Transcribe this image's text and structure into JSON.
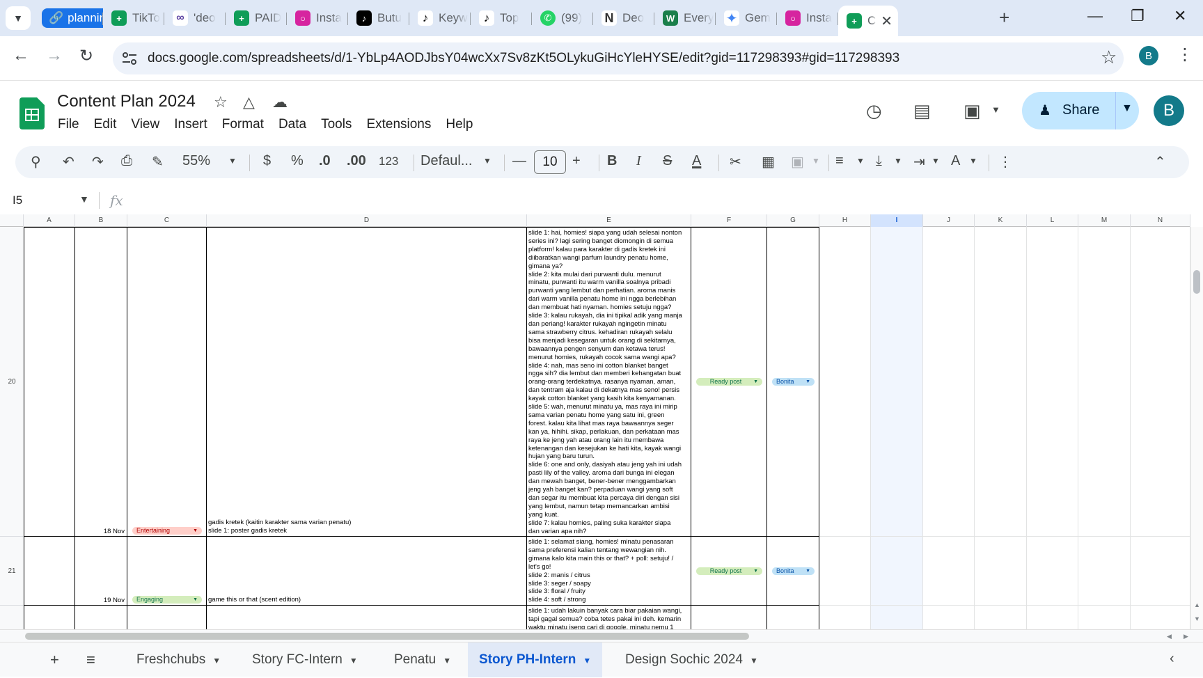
{
  "browser": {
    "tab_group_label": "planning",
    "tabs": [
      {
        "title": "TikTo",
        "icon": "sheets-icon",
        "color": "#0f9d58"
      },
      {
        "title": "'deo",
        "icon": "claude-icon",
        "color": "#5b3fa0"
      },
      {
        "title": "PAID",
        "icon": "sheets-icon",
        "color": "#0f9d58"
      },
      {
        "title": "Insta",
        "icon": "instagram-icon",
        "color": "#d6249f"
      },
      {
        "title": "Butu",
        "icon": "tiktok-icon",
        "color": "#000000"
      },
      {
        "title": "Keyw",
        "icon": "tiktok-icon",
        "color": "#000000"
      },
      {
        "title": "Top",
        "icon": "tiktok-icon",
        "color": "#000000"
      },
      {
        "title": "(99)",
        "icon": "whatsapp-icon",
        "color": "#25d366"
      },
      {
        "title": "Deo",
        "icon": "notion-icon",
        "color": "#333333"
      },
      {
        "title": "Every",
        "icon": "wix-icon",
        "color": "#1a7f4b"
      },
      {
        "title": "Gem",
        "icon": "gemini-icon",
        "color": "#4285f4"
      },
      {
        "title": "Insta",
        "icon": "instagram-icon",
        "color": "#d6249f"
      }
    ],
    "active_tab_title": "C",
    "url": "docs.google.com/spreadsheets/d/1-YbLp4AODJbsY04wcXx7Sv8zKt5OLykuGiHcYleHYSE/edit?gid=117298393#gid=117298393",
    "profile_initial": "B"
  },
  "sheets": {
    "title": "Content Plan 2024",
    "menu": [
      "File",
      "Edit",
      "View",
      "Insert",
      "Format",
      "Data",
      "Tools",
      "Extensions",
      "Help"
    ],
    "share_label": "Share",
    "account_initial": "B",
    "toolbar": {
      "zoom": "55%",
      "currency": "$",
      "percent": "%",
      "decrease_decimal": ".0",
      "increase_decimal": ".00",
      "number_format": "123",
      "font": "Defaul...",
      "font_size": "10"
    },
    "namebox": "I5",
    "fx": "fx"
  },
  "grid": {
    "columns": [
      "A",
      "B",
      "C",
      "D",
      "E",
      "F",
      "G",
      "H",
      "I",
      "J",
      "K",
      "L",
      "M",
      "N"
    ],
    "selected_column": "I",
    "rows": [
      {
        "number": "20",
        "date": "18 Nov",
        "category": "Entertaining",
        "title_lines": [
          "gadis kretek (kaitin karakter sama varian penatu)",
          "slide 1: poster gadis kretek"
        ],
        "script_lines": [
          "slide 1: hai, homies! siapa yang udah selesai nonton",
          "series ini? lagi sering banget diomongin di semua",
          "platform! kalau para karakter di gadis kretek ini",
          "diibaratkan wangi parfum laundry penatu home,",
          "gimana ya?",
          "slide 2: kita mulai dari purwanti dulu. menurut",
          "minatu, purwanti itu warm vanilla soalnya pribadi",
          "purwanti yang lembut dan perhatian. aroma manis",
          "dari warm vanilla penatu home ini ngga berlebihan",
          "dan membuat hati nyaman. homies setuju ngga?",
          "slide 3: kalau rukayah, dia ini tipikal adik yang manja",
          "dan periang! karakter rukayah ngingetin minatu",
          "sama strawberry citrus. kehadiran rukayah selalu",
          "bisa menjadi kesegaran untuk orang di sekitarnya,",
          "bawaannya pengen senyum dan ketawa terus!",
          "menurut homies, rukayah cocok sama wangi apa?",
          "slide 4: nah, mas seno ini cotton blanket banget",
          "ngga sih? dia lembut dan memberi kehangatan buat",
          "orang-orang terdekatnya. rasanya nyaman, aman,",
          "dan tentram aja kalau di dekatnya mas seno! persis",
          "kayak cotton blanket yang kasih kita kenyamanan.",
          "slide 5: wah, menurut minatu ya, mas raya ini mirip",
          "sama varian penatu home yang satu ini, green",
          "forest. kalau kita lihat mas raya bawaannya seger",
          "kan ya, hihihi. sikap, perlakuan, dan perkataan mas",
          "raya ke jeng yah atau orang lain itu membawa",
          "ketenangan dan kesejukan ke hati kita, kayak wangi",
          "hujan yang baru turun.",
          "slide 6: one and only, dasiyah atau jeng yah ini udah",
          "pasti lily of the valley. aroma dari bunga ini elegan",
          "dan mewah banget, bener-bener menggambarkan",
          "jeng yah banget kan? perpaduan wangi yang soft",
          "dan segar itu membuat kita percaya diri dengan sisi",
          "yang lembut, namun tetap memancarkan ambisi",
          "yang kuat.",
          "slide 7: kalau homies, paling suka karakter siapa",
          "dan varian apa nih?"
        ],
        "status": "Ready post",
        "owner": "Bonita"
      },
      {
        "number": "21",
        "date": "19 Nov",
        "category": "Engaging",
        "title_lines": [
          "game this or that (scent edition)"
        ],
        "script_lines": [
          "slide 1: selamat siang, homies! minatu penasaran",
          "sama preferensi kalian tentang wewangian nih.",
          "gimana kalo kita main this or that? + poll: setuju! /",
          "let's go!",
          "slide 2: manis / citrus",
          "slide 3: seger / soapy",
          "slide 3: floral / fruity",
          "slide 4: soft / strong"
        ],
        "status": "Ready post",
        "owner": "Bonita"
      },
      {
        "number": "",
        "script_lines": [
          "slide 1: udah lakuin banyak cara biar pakaian wangi,",
          "tapi gagal semua? coba tetes pakai ini deh. kemarin",
          "waktu minatu iseng cari di google, minatu nemu 1"
        ]
      }
    ]
  },
  "sheet_tabs": [
    "Freshchubs",
    "Story FC-Intern",
    "Penatu",
    "Story PH-Intern",
    "Design Sochic 2024"
  ],
  "active_sheet_tab": "Story PH-Intern",
  "colors": {
    "accent": "#0b57d0",
    "sheets_green": "#0f9d58",
    "share_bg": "#c2e7ff"
  }
}
